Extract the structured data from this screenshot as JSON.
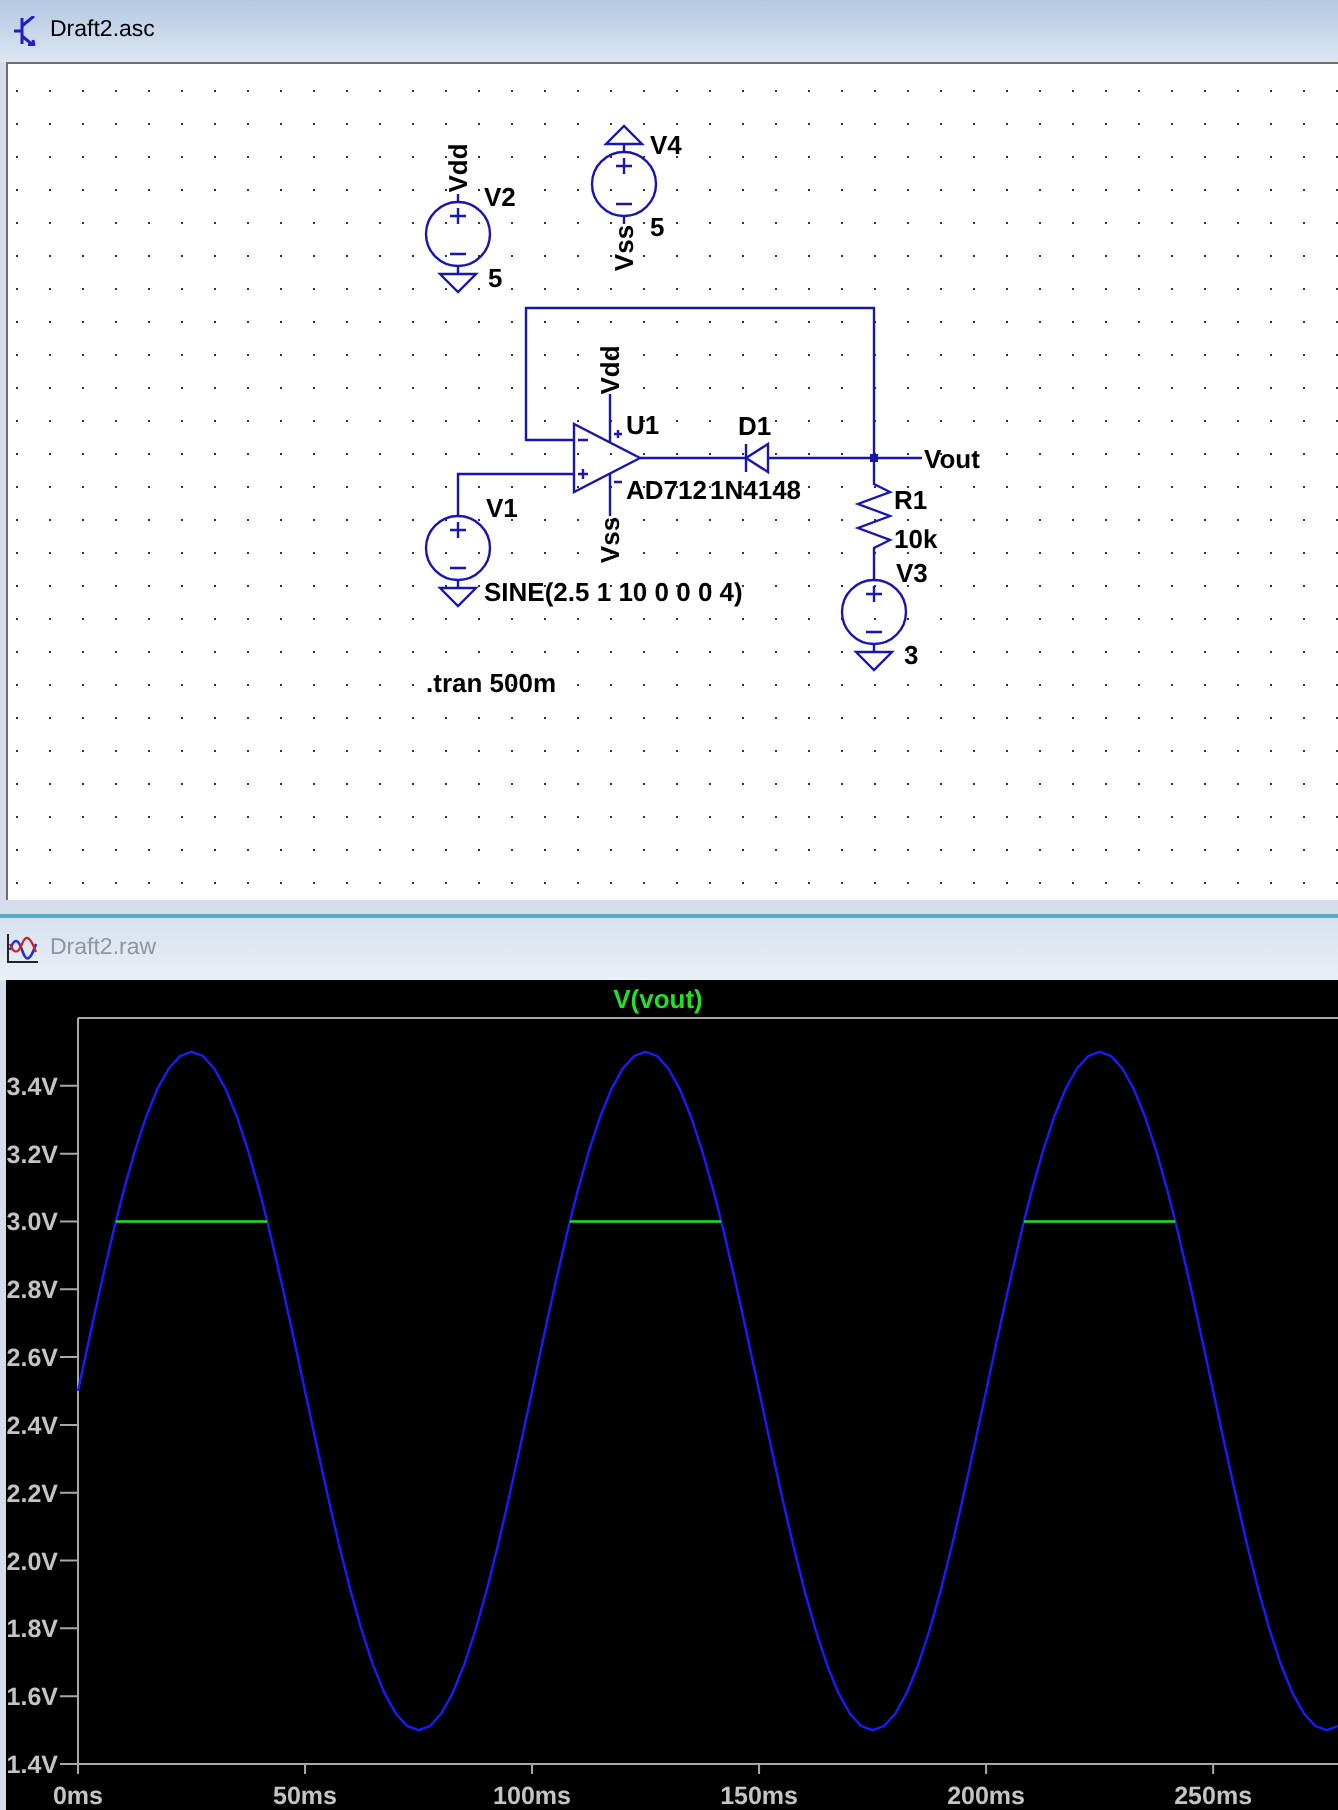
{
  "schematic_window": {
    "title": "Draft2.asc",
    "active": true,
    "components": [
      {
        "kind": "voltage_source",
        "ref": "V2",
        "value": "5"
      },
      {
        "kind": "voltage_source",
        "ref": "V4",
        "value": "5"
      },
      {
        "kind": "opamp",
        "ref": "U1",
        "value": "AD712"
      },
      {
        "kind": "diode",
        "ref": "D1",
        "value": "1N4148"
      },
      {
        "kind": "voltage_source",
        "ref": "V1",
        "value": "SINE(2.5 1 10 0 0 0 4)"
      },
      {
        "kind": "resistor",
        "ref": "R1",
        "value": "10k"
      },
      {
        "kind": "voltage_source",
        "ref": "V3",
        "value": "3"
      }
    ],
    "net_labels": [
      "Vdd",
      "Vss",
      "Vdd",
      "Vss",
      "Vout"
    ],
    "directive": ".tran 500m"
  },
  "waveform_window": {
    "title": "Draft2.raw",
    "active": false,
    "chart_data": {
      "type": "line",
      "x": [
        0,
        2.5,
        5,
        7.5,
        8.333,
        10,
        12.5,
        15,
        17.5,
        20,
        22.5,
        25,
        27.5,
        30,
        32.5,
        35,
        37.5,
        40,
        41.667,
        42.5,
        45,
        47.5,
        50,
        52.5,
        55,
        57.5,
        60,
        62.5,
        65,
        67.5,
        70,
        72.5,
        75,
        77.5,
        80,
        82.5,
        85,
        87.5,
        90,
        92.5,
        95,
        97.5,
        100,
        102.5,
        105,
        107.5,
        108.333,
        110,
        112.5,
        115,
        117.5,
        120,
        122.5,
        125,
        127.5,
        130,
        132.5,
        135,
        137.5,
        140,
        141.667,
        142.5,
        145,
        147.5,
        150,
        152.5,
        155,
        157.5,
        160,
        162.5,
        165,
        167.5,
        170,
        172.5,
        175,
        177.5,
        180,
        182.5,
        185,
        187.5,
        190,
        192.5,
        195,
        197.5,
        200,
        202.5,
        205,
        207.5,
        208.333,
        210,
        212.5,
        215,
        217.5,
        220,
        222.5,
        225,
        227.5,
        230,
        232.5,
        235,
        237.5,
        240,
        241.667,
        242.5,
        245,
        247.5,
        250,
        252.5,
        255,
        257.5,
        260,
        262.5,
        265,
        267.5,
        270,
        272.5,
        275,
        277.5
      ],
      "series": [
        {
          "color": "#1a1aff",
          "values": [
            2.5,
            2.656,
            2.809,
            2.954,
            3,
            3.088,
            3.207,
            3.309,
            3.391,
            3.451,
            3.488,
            3.5,
            3.488,
            3.451,
            3.391,
            3.309,
            3.207,
            3.088,
            3,
            2.954,
            2.809,
            2.656,
            2.5,
            2.344,
            2.191,
            2.046,
            1.912,
            1.793,
            1.691,
            1.609,
            1.549,
            1.512,
            1.5,
            1.512,
            1.549,
            1.609,
            1.691,
            1.793,
            1.912,
            2.046,
            2.191,
            2.344,
            2.5,
            2.656,
            2.809,
            2.954,
            3,
            3.088,
            3.207,
            3.309,
            3.391,
            3.451,
            3.488,
            3.5,
            3.488,
            3.451,
            3.391,
            3.309,
            3.207,
            3.088,
            3,
            2.954,
            2.809,
            2.656,
            2.5,
            2.344,
            2.191,
            2.046,
            1.912,
            1.793,
            1.691,
            1.609,
            1.549,
            1.512,
            1.5,
            1.512,
            1.549,
            1.609,
            1.691,
            1.793,
            1.912,
            2.046,
            2.191,
            2.344,
            2.5,
            2.656,
            2.809,
            2.954,
            3,
            3.088,
            3.207,
            3.309,
            3.391,
            3.451,
            3.488,
            3.5,
            3.488,
            3.451,
            3.391,
            3.309,
            3.207,
            3.088,
            3,
            2.954,
            2.809,
            2.656,
            2.5,
            2.344,
            2.191,
            2.046,
            1.912,
            1.793,
            1.691,
            1.609,
            1.549,
            1.512,
            1.5,
            1.512
          ]
        },
        {
          "name": "V(vout)",
          "color": "#22e022",
          "values": [
            null,
            null,
            null,
            null,
            3,
            3,
            3,
            3,
            3,
            3,
            3,
            3,
            3,
            3,
            3,
            3,
            3,
            3,
            3,
            null,
            null,
            null,
            null,
            null,
            null,
            null,
            null,
            null,
            null,
            null,
            null,
            null,
            null,
            null,
            null,
            null,
            null,
            null,
            null,
            null,
            null,
            null,
            null,
            null,
            null,
            null,
            3,
            3,
            3,
            3,
            3,
            3,
            3,
            3,
            3,
            3,
            3,
            3,
            3,
            3,
            3,
            null,
            null,
            null,
            null,
            null,
            null,
            null,
            null,
            null,
            null,
            null,
            null,
            null,
            null,
            null,
            null,
            null,
            null,
            null,
            null,
            null,
            null,
            null,
            null,
            null,
            null,
            null,
            3,
            3,
            3,
            3,
            3,
            3,
            3,
            3,
            3,
            3,
            3,
            3,
            3,
            3,
            3,
            null,
            null,
            null,
            null,
            null,
            null,
            null,
            null,
            null,
            null,
            null,
            null,
            null,
            null,
            null
          ]
        }
      ],
      "xlim": [
        0,
        277.5
      ],
      "ylim": [
        1.4,
        3.6
      ],
      "xticks": [
        {
          "value": 0,
          "label": "0ms"
        },
        {
          "value": 50,
          "label": "50ms"
        },
        {
          "value": 100,
          "label": "100ms"
        },
        {
          "value": 150,
          "label": "150ms"
        },
        {
          "value": 200,
          "label": "200ms"
        },
        {
          "value": 250,
          "label": "250ms"
        }
      ],
      "yticks": [
        {
          "value": 1.4,
          "label": "1.4V"
        },
        {
          "value": 1.6,
          "label": "1.6V"
        },
        {
          "value": 1.8,
          "label": "1.8V"
        },
        {
          "value": 2.0,
          "label": "2.0V"
        },
        {
          "value": 2.2,
          "label": "2.2V"
        },
        {
          "value": 2.4,
          "label": "2.4V"
        },
        {
          "value": 2.6,
          "label": "2.6V"
        },
        {
          "value": 2.8,
          "label": "2.8V"
        },
        {
          "value": 3.0,
          "label": "3.0V"
        },
        {
          "value": 3.2,
          "label": "3.2V"
        },
        {
          "value": 3.4,
          "label": "3.4V"
        }
      ]
    }
  }
}
